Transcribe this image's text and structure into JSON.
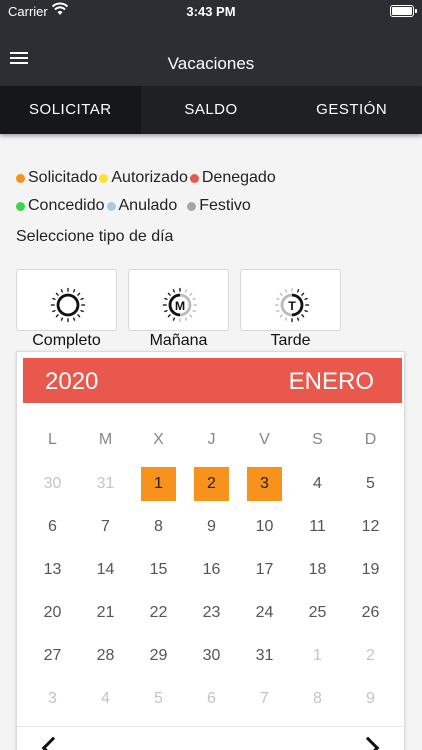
{
  "status": {
    "carrier": "Carrier",
    "time": "3:43 PM"
  },
  "header": {
    "title": "Vacaciones"
  },
  "tabs": [
    {
      "label": "SOLICITAR",
      "active": true
    },
    {
      "label": "SALDO",
      "active": false
    },
    {
      "label": "GESTIÓN",
      "active": false
    }
  ],
  "legend": [
    {
      "label": "Solicitado",
      "color": "#f7921c"
    },
    {
      "label": "Autorizado",
      "color": "#f5e52b"
    },
    {
      "label": "Denegado",
      "color": "#e8584d"
    },
    {
      "label": "Concedido",
      "color": "#3ad64a"
    },
    {
      "label": "Anulado",
      "color": "#a9c9dc"
    },
    {
      "label": "Festivo",
      "color": "#a6a6a6"
    }
  ],
  "subtitle": "Seleccione tipo de día",
  "day_types": [
    {
      "label": "Completo",
      "icon": "sun-icon",
      "letter": ""
    },
    {
      "label": "Mañana",
      "icon": "sun-morning-icon",
      "letter": "M"
    },
    {
      "label": "Tarde",
      "icon": "sun-afternoon-icon",
      "letter": "T"
    }
  ],
  "calendar": {
    "year": "2020",
    "month": "ENERO",
    "weekdays": [
      "L",
      "M",
      "X",
      "J",
      "V",
      "S",
      "D"
    ],
    "weeks": [
      [
        {
          "d": "30",
          "o": true
        },
        {
          "d": "31",
          "o": true
        },
        {
          "d": "1",
          "s": true
        },
        {
          "d": "2",
          "s": true
        },
        {
          "d": "3",
          "s": true
        },
        {
          "d": "4"
        },
        {
          "d": "5"
        }
      ],
      [
        {
          "d": "6"
        },
        {
          "d": "7"
        },
        {
          "d": "8"
        },
        {
          "d": "9"
        },
        {
          "d": "10"
        },
        {
          "d": "11"
        },
        {
          "d": "12"
        }
      ],
      [
        {
          "d": "13"
        },
        {
          "d": "14"
        },
        {
          "d": "15"
        },
        {
          "d": "16"
        },
        {
          "d": "17"
        },
        {
          "d": "18"
        },
        {
          "d": "19"
        }
      ],
      [
        {
          "d": "20"
        },
        {
          "d": "21"
        },
        {
          "d": "22"
        },
        {
          "d": "23"
        },
        {
          "d": "24"
        },
        {
          "d": "25"
        },
        {
          "d": "26"
        }
      ],
      [
        {
          "d": "27"
        },
        {
          "d": "28"
        },
        {
          "d": "29"
        },
        {
          "d": "30"
        },
        {
          "d": "31"
        },
        {
          "d": "1",
          "o": true
        },
        {
          "d": "2",
          "o": true
        }
      ],
      [
        {
          "d": "3",
          "o": true
        },
        {
          "d": "4",
          "o": true
        },
        {
          "d": "5",
          "o": true
        },
        {
          "d": "6",
          "o": true
        },
        {
          "d": "7",
          "o": true
        },
        {
          "d": "8",
          "o": true
        },
        {
          "d": "9",
          "o": true
        }
      ]
    ]
  }
}
